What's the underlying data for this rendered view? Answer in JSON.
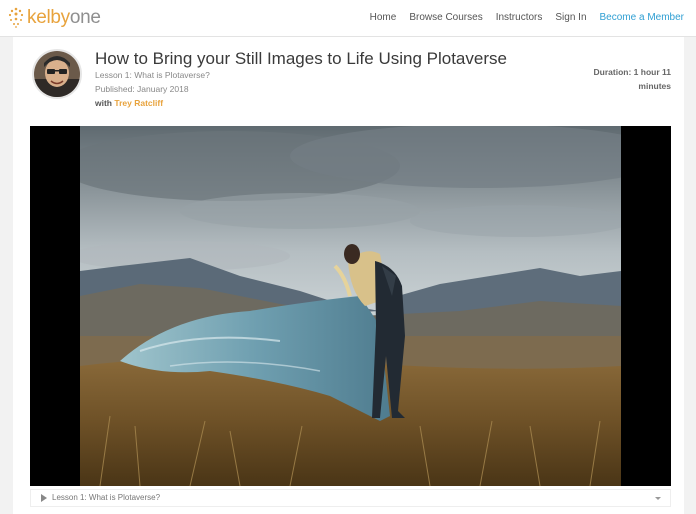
{
  "nav": {
    "logo": {
      "part1": "kelby",
      "part2": "one"
    },
    "links": [
      "Home",
      "Browse Courses",
      "Instructors",
      "Sign In"
    ],
    "member_link": "Become a Member"
  },
  "course": {
    "title": "How to Bring your Still Images to Life Using Plotaverse",
    "lesson": "Lesson 1: What is Plotaverse?",
    "published": "Published: January 2018",
    "with_label": "with",
    "author": "Trey Ratcliff",
    "duration": "Duration: 1 hour 11 minutes"
  },
  "player": {
    "lesson_label": "Lesson 1: What is Plotaverse?",
    "icons": [
      "play-icon",
      "caret-down-icon"
    ]
  },
  "colors": {
    "brand_orange": "#e8a33d",
    "link_blue": "#2f9fd3"
  }
}
